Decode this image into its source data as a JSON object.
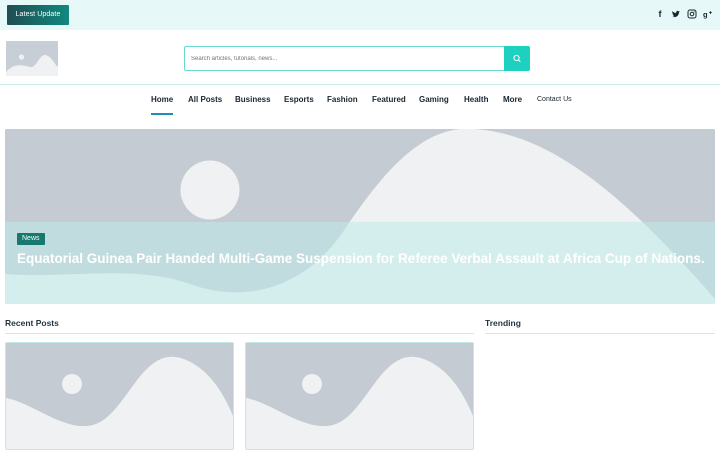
{
  "topbar": {
    "latest_label": "Latest Update",
    "social_icons": [
      "facebook-icon",
      "twitter-icon",
      "instagram-icon",
      "google-plus-icon"
    ]
  },
  "search": {
    "placeholder": "Search articles, tutorials, news..."
  },
  "nav": {
    "items": [
      {
        "label": "Home",
        "active": true
      },
      {
        "label": "All Posts"
      },
      {
        "label": "Business"
      },
      {
        "label": "Esports"
      },
      {
        "label": "Fashion"
      },
      {
        "label": "Featured"
      },
      {
        "label": "Gaming"
      },
      {
        "label": "Health"
      },
      {
        "label": "More"
      },
      {
        "label": "Contact Us"
      }
    ]
  },
  "hero": {
    "category": "News",
    "title": "Equatorial Guinea Pair Handed Multi-Game Suspension for Referee Verbal Assault at Africa Cup of Nations."
  },
  "sections": {
    "recent": "Recent Posts",
    "trending": "Trending"
  },
  "colors": {
    "accent": "#1ed0c0",
    "badge": "#17786f",
    "topbar_bg": "#e6f8f7",
    "placeholder_bg": "#c5cbd2"
  }
}
